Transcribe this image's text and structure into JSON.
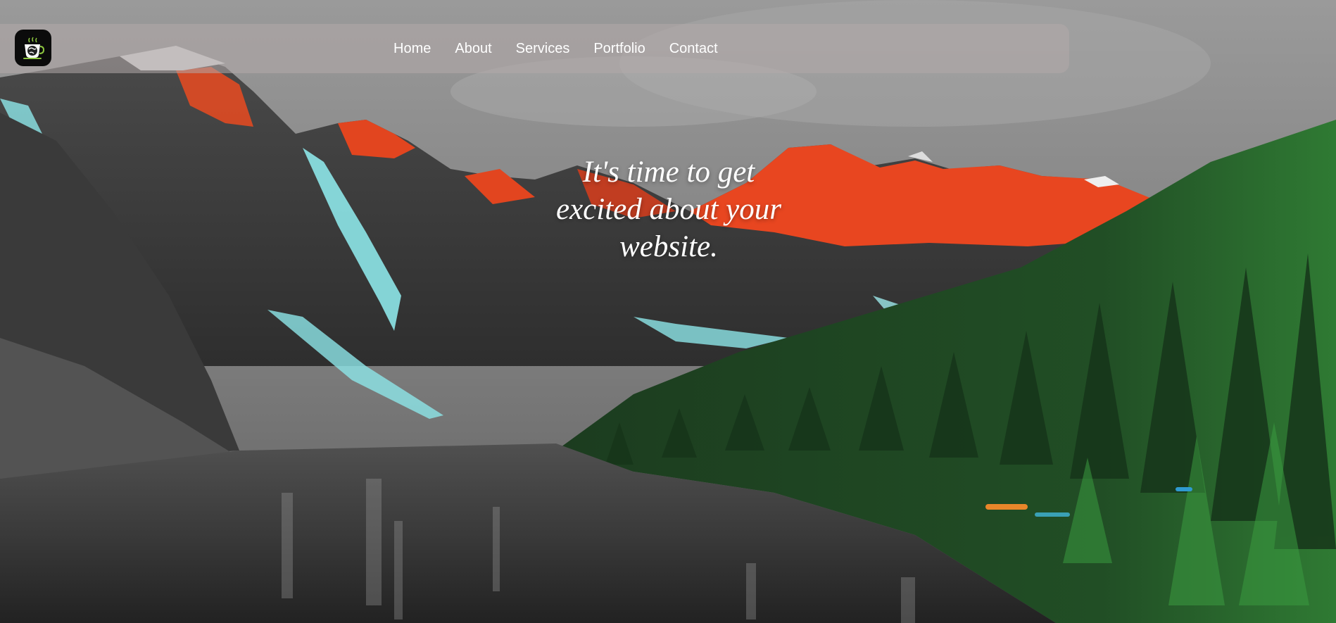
{
  "logo": {
    "icon": "coffee-cup-globe-icon",
    "accent": "#8dc63f"
  },
  "nav": {
    "items": [
      {
        "label": "Home"
      },
      {
        "label": "About"
      },
      {
        "label": "Services"
      },
      {
        "label": "Portfolio"
      },
      {
        "label": "Contact"
      }
    ]
  },
  "hero": {
    "line1": "It's time to get",
    "line2": "excited about your",
    "line3": "website."
  },
  "background": {
    "icon": "mountain-lake-landscape-image",
    "sky": "#8c8c8c",
    "peak_glow": "#e8401f",
    "glacier": "#7fe3e6",
    "forest": "#1f4a22"
  }
}
